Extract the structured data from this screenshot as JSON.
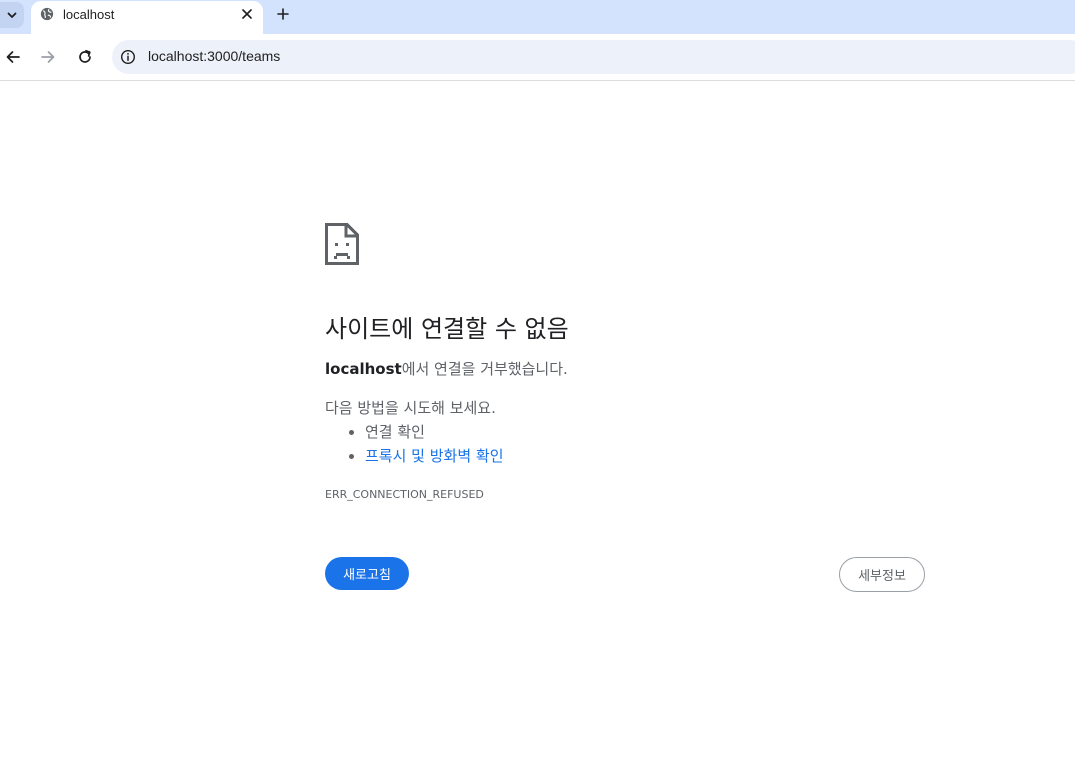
{
  "browser": {
    "tab": {
      "title": "localhost"
    },
    "address": {
      "url": "localhost:3000/teams"
    }
  },
  "error": {
    "heading": "사이트에 연결할 수 없음",
    "host": "localhost",
    "message_suffix": "에서 연결을 거부했습니다.",
    "suggestions_label": "다음 방법을 시도해 보세요.",
    "suggestions": [
      {
        "text": "연결 확인",
        "link": false
      },
      {
        "text": "프록시 및 방화벽 확인",
        "link": true
      }
    ],
    "code": "ERR_CONNECTION_REFUSED",
    "reload_label": "새로고침",
    "details_label": "세부정보"
  },
  "colors": {
    "tabstrip": "#d3e3fd",
    "omnibox": "#edf2fa",
    "primary_button": "#1a73e8",
    "link": "#1a73e8"
  },
  "icons": {
    "tab_search": "chevron-down-icon",
    "favicon": "globe-icon",
    "tab_close": "close-icon",
    "new_tab": "plus-icon",
    "back": "back-arrow-icon",
    "forward": "forward-arrow-icon",
    "reload": "reload-icon",
    "site_info": "info-icon",
    "error": "sad-page-icon"
  }
}
